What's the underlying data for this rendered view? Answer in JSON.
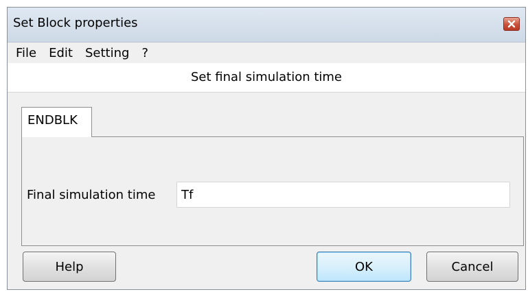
{
  "window": {
    "title": "Set Block properties"
  },
  "menu": {
    "items": [
      {
        "label": "File"
      },
      {
        "label": "Edit"
      },
      {
        "label": "Setting"
      },
      {
        "label": "?"
      }
    ]
  },
  "header": {
    "text": "Set final simulation time"
  },
  "tabs": [
    {
      "label": "ENDBLK"
    }
  ],
  "form": {
    "final_time_label": "Final simulation time",
    "final_time_value": "Tf"
  },
  "buttons": {
    "help": "Help",
    "ok": "OK",
    "cancel": "Cancel"
  },
  "colors": {
    "titlebar": "#cdd9e6",
    "close_button": "#c9503a",
    "default_button_border": "#3c7fb1"
  },
  "icons": {
    "close": "close-icon"
  }
}
